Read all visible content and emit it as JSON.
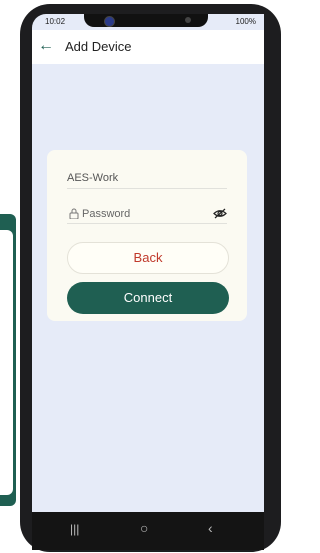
{
  "status_bar": {
    "time": "10:02",
    "battery": "100%"
  },
  "app_bar": {
    "back_icon": "arrow-left-icon",
    "title": "Add Device"
  },
  "form": {
    "ssid": "AES-Work",
    "password_placeholder": "Password",
    "lock_icon": "lock-icon",
    "visibility_icon": "eye-off-icon"
  },
  "buttons": {
    "back": "Back",
    "connect": "Connect"
  },
  "nav": {
    "recents_icon": "recents-icon",
    "home_icon": "home-icon",
    "back_icon": "back-icon"
  },
  "colors": {
    "accent": "#1f5f52",
    "danger": "#c0392b",
    "screen_bg": "#e6ebf8",
    "card_bg": "#fbfaf2"
  }
}
